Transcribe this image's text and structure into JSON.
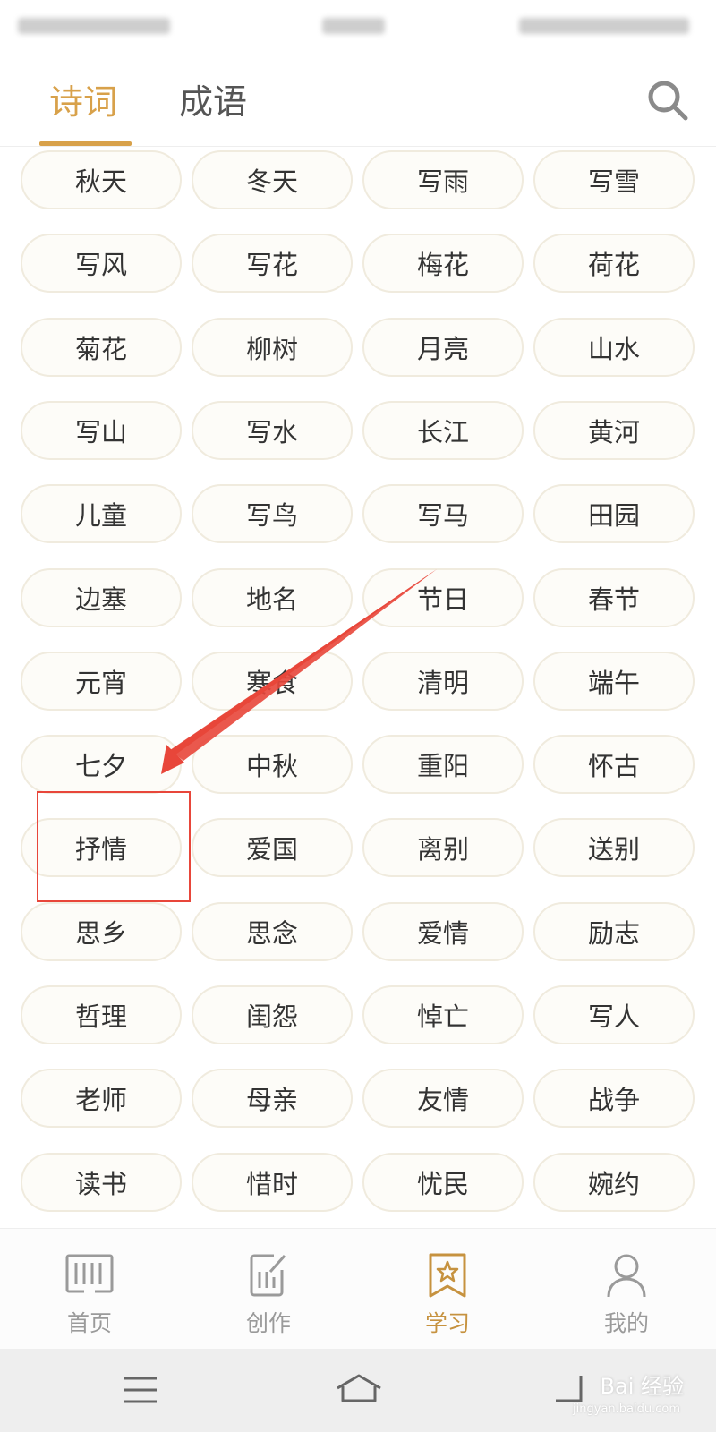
{
  "header": {
    "tabs": [
      {
        "label": "诗词",
        "active": true
      },
      {
        "label": "成语",
        "active": false
      }
    ]
  },
  "topics": [
    [
      "秋天",
      "冬天",
      "写雨",
      "写雪"
    ],
    [
      "写风",
      "写花",
      "梅花",
      "荷花"
    ],
    [
      "菊花",
      "柳树",
      "月亮",
      "山水"
    ],
    [
      "写山",
      "写水",
      "长江",
      "黄河"
    ],
    [
      "儿童",
      "写鸟",
      "写马",
      "田园"
    ],
    [
      "边塞",
      "地名",
      "节日",
      "春节"
    ],
    [
      "元宵",
      "寒食",
      "清明",
      "端午"
    ],
    [
      "七夕",
      "中秋",
      "重阳",
      "怀古"
    ],
    [
      "抒情",
      "爱国",
      "离别",
      "送别"
    ],
    [
      "思乡",
      "思念",
      "爱情",
      "励志"
    ],
    [
      "哲理",
      "闺怨",
      "悼亡",
      "写人"
    ],
    [
      "老师",
      "母亲",
      "友情",
      "战争"
    ],
    [
      "读书",
      "惜时",
      "忧民",
      "婉约"
    ]
  ],
  "annotation": {
    "highlighted": "抒情",
    "color": "#e8463a"
  },
  "bottom_nav": {
    "items": [
      {
        "label": "首页",
        "icon": "home-books-icon",
        "active": false
      },
      {
        "label": "创作",
        "icon": "write-icon",
        "active": false
      },
      {
        "label": "学习",
        "icon": "star-bookmark-icon",
        "active": true
      },
      {
        "label": "我的",
        "icon": "person-icon",
        "active": false
      }
    ]
  },
  "watermark": {
    "text": "Bai 经验",
    "url": "jingyan.baidu.com"
  },
  "colors": {
    "accent": "#d8a14a",
    "chip_bg": "#fdfcf8",
    "chip_border": "#f0ebde",
    "annotation": "#e8463a"
  }
}
